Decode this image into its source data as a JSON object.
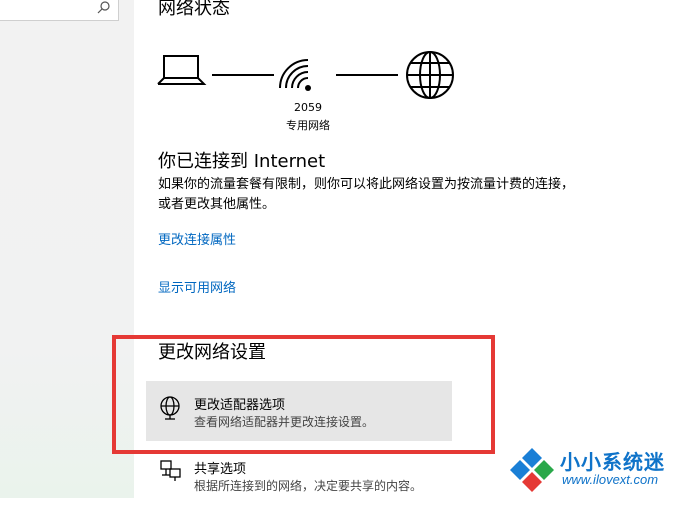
{
  "page": {
    "title": "网络状态"
  },
  "network": {
    "name": "2059",
    "type": "专用网络"
  },
  "status": {
    "heading": "你已连接到 Internet",
    "description": "如果你的流量套餐有限制，则你可以将此网络设置为按流量计费的连接，或者更改其他属性。"
  },
  "links": {
    "change_properties": "更改连接属性",
    "show_networks": "显示可用网络"
  },
  "settings": {
    "title": "更改网络设置",
    "options": [
      {
        "title": "更改适配器选项",
        "subtitle": "查看网络适配器并更改连接设置。"
      },
      {
        "title": "共享选项",
        "subtitle": "根据所连接到的网络，决定要共享的内容。"
      }
    ]
  },
  "watermark": {
    "cn": "小小系统迷",
    "url": "www.ilovext.com"
  },
  "colors": {
    "accent": "#0067c0",
    "highlight": "#e53935",
    "watermark": "#0f73c9"
  }
}
